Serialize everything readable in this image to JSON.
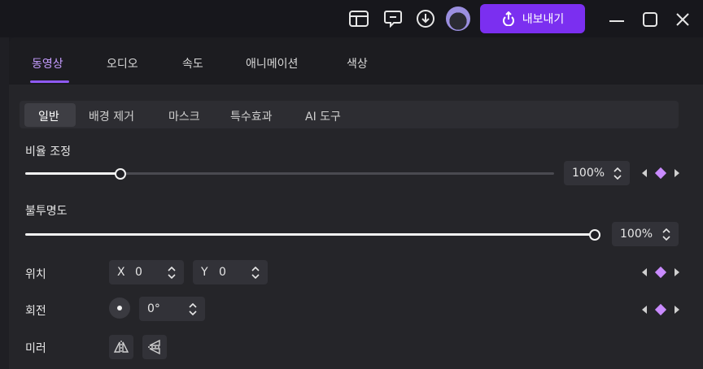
{
  "header": {
    "export_label": "내보내기",
    "icons": [
      "layout-icon",
      "feedback-icon",
      "download-icon",
      "avatar",
      "upload-icon",
      "minimize-icon",
      "maximize-icon",
      "close-icon"
    ]
  },
  "tabs": [
    {
      "label": "동영상",
      "active": true
    },
    {
      "label": "오디오",
      "active": false
    },
    {
      "label": "속도",
      "active": false
    },
    {
      "label": "애니메이션",
      "active": false
    },
    {
      "label": "색상",
      "active": false
    }
  ],
  "subtabs": [
    {
      "label": "일반",
      "active": true
    },
    {
      "label": "배경 제거",
      "active": false
    },
    {
      "label": "마스크",
      "active": false
    },
    {
      "label": "특수효과",
      "active": false
    },
    {
      "label": "AI 도구",
      "active": false
    }
  ],
  "scale": {
    "label": "비율 조정",
    "value": "100%",
    "slider_fraction": 0.18
  },
  "opacity": {
    "label": "불투명도",
    "value": "100%",
    "slider_fraction": 1.0
  },
  "position": {
    "label": "위치",
    "x_label": "X",
    "x_value": "0",
    "y_label": "Y",
    "y_value": "0"
  },
  "rotation": {
    "label": "회전",
    "value": "0°"
  },
  "mirror": {
    "label": "미러"
  },
  "colors": {
    "accent": "#7b2ff0",
    "active_tab": "#c59cff",
    "keyframe": "#c98bff"
  }
}
